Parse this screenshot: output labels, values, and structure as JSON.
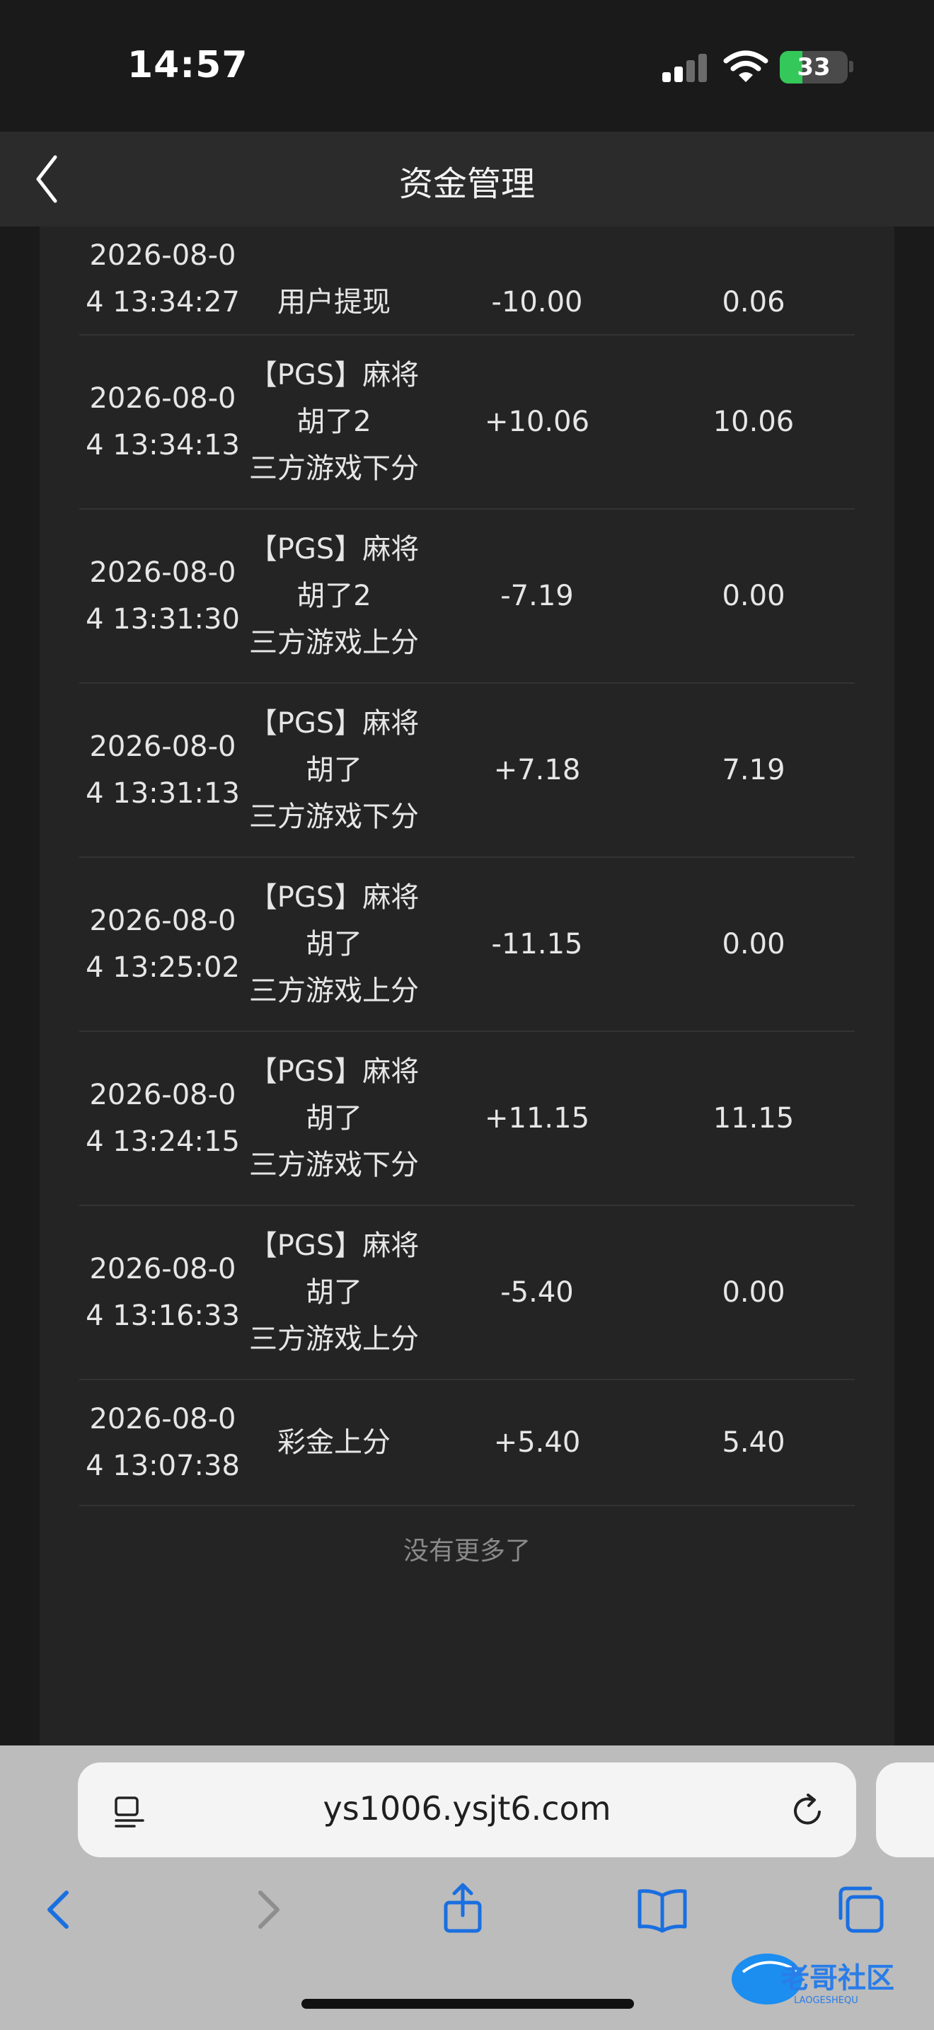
{
  "status_bar": {
    "time": "14:57",
    "battery": "33",
    "battery_level": 0.33
  },
  "header": {
    "title": "资金管理"
  },
  "records": [
    {
      "time": [
        "2026-08-0",
        "4 13:34:27"
      ],
      "desc": [
        "用户提现"
      ],
      "amount": "-10.00",
      "balance": "0.06"
    },
    {
      "time": [
        "2026-08-0",
        "4 13:34:13"
      ],
      "desc": [
        "【PGS】麻将",
        "胡了2",
        "三方游戏下分"
      ],
      "amount": "+10.06",
      "balance": "10.06"
    },
    {
      "time": [
        "2026-08-0",
        "4 13:31:30"
      ],
      "desc": [
        "【PGS】麻将",
        "胡了2",
        "三方游戏上分"
      ],
      "amount": "-7.19",
      "balance": "0.00"
    },
    {
      "time": [
        "2026-08-0",
        "4 13:31:13"
      ],
      "desc": [
        "【PGS】麻将",
        "胡了",
        "三方游戏下分"
      ],
      "amount": "+7.18",
      "balance": "7.19"
    },
    {
      "time": [
        "2026-08-0",
        "4 13:25:02"
      ],
      "desc": [
        "【PGS】麻将",
        "胡了",
        "三方游戏上分"
      ],
      "amount": "-11.15",
      "balance": "0.00"
    },
    {
      "time": [
        "2026-08-0",
        "4 13:24:15"
      ],
      "desc": [
        "【PGS】麻将",
        "胡了",
        "三方游戏下分"
      ],
      "amount": "+11.15",
      "balance": "11.15"
    },
    {
      "time": [
        "2026-08-0",
        "4 13:16:33"
      ],
      "desc": [
        "【PGS】麻将",
        "胡了",
        "三方游戏上分"
      ],
      "amount": "-5.40",
      "balance": "0.00"
    },
    {
      "time": [
        "2026-08-0",
        "4 13:07:38"
      ],
      "desc": [
        "彩金上分"
      ],
      "amount": "+5.40",
      "balance": "5.40"
    }
  ],
  "no_more_text": "没有更多了",
  "browser": {
    "url": "ys1006.ysjt6.com"
  },
  "watermark": {
    "text": "老哥社区",
    "subtext": "LAOGESHEQU"
  },
  "colors": {
    "accent": "#1a6fe0",
    "battery_green": "#34c759"
  }
}
